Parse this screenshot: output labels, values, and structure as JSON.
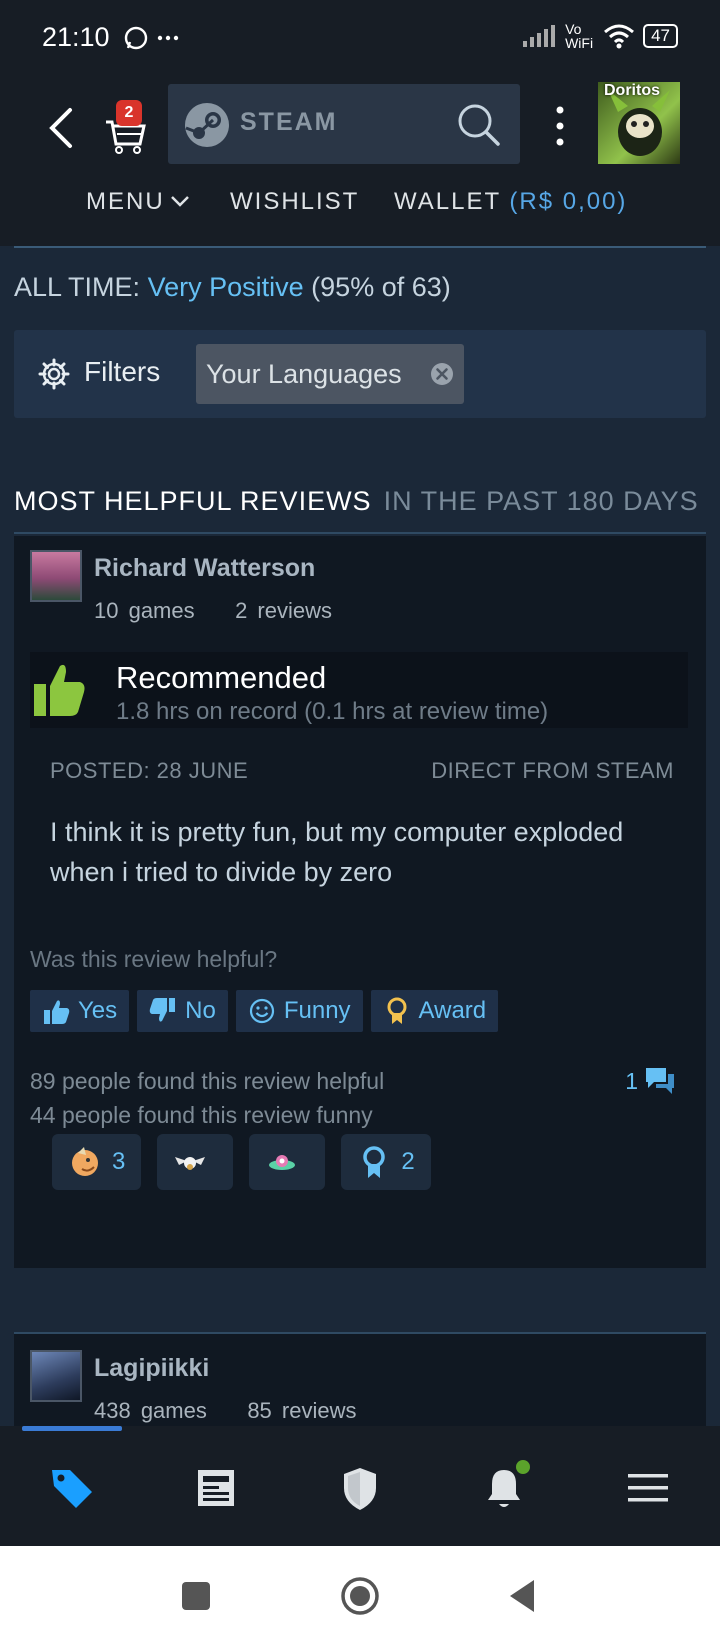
{
  "status_bar": {
    "time": "21:10",
    "network": "Vo WiFi",
    "battery": "47"
  },
  "header": {
    "cart_count": "2",
    "search_brand": "STEAM",
    "avatar_label": "Doritos",
    "nav": {
      "menu": "MENU",
      "wishlist": "WISHLIST",
      "wallet_label": "WALLET",
      "wallet_amount": "(R$ 0,00)"
    }
  },
  "summary": {
    "prefix": "ALL TIME:",
    "rating": "Very Positive",
    "detail": "(95% of 63)"
  },
  "filters": {
    "label": "Filters",
    "chip": "Your Languages"
  },
  "section": {
    "title": "MOST HELPFUL REVIEWS",
    "subtitle": "IN THE PAST 180 DAYS"
  },
  "review": {
    "author": "Richard Watterson",
    "games": "10 games",
    "reviews": "2 reviews",
    "verdict": "Recommended",
    "hours": "1.8 hrs on record (0.1 hrs at review time)",
    "posted": "POSTED: 28 JUNE",
    "source": "DIRECT FROM STEAM",
    "text": "I think it is pretty fun, but my computer exploded when i tried to divide by zero",
    "helpful_question": "Was this review helpful?",
    "buttons": {
      "yes": "Yes",
      "no": "No",
      "funny": "Funny",
      "award": "Award"
    },
    "helpful_count": "89 people found this review helpful",
    "funny_count": "44 people found this review funny",
    "comments": "1",
    "awards": [
      {
        "icon": "dragon-award-icon",
        "count": "3"
      },
      {
        "icon": "winged-award-icon",
        "count": ""
      },
      {
        "icon": "ufo-award-icon",
        "count": ""
      },
      {
        "icon": "ribbon-award-icon",
        "count": "2"
      }
    ]
  },
  "next_review": {
    "author": "Lagipiikki",
    "games": "438 games",
    "reviews": "85 reviews"
  },
  "bottom_nav": [
    "store-tag-icon",
    "news-icon",
    "guard-shield-icon",
    "notification-bell-icon",
    "hamburger-menu-icon"
  ],
  "colors": {
    "accent": "#66c0f4",
    "badge": "#d9342b",
    "recommend": "#8cc63f",
    "background": "#1b2838"
  }
}
